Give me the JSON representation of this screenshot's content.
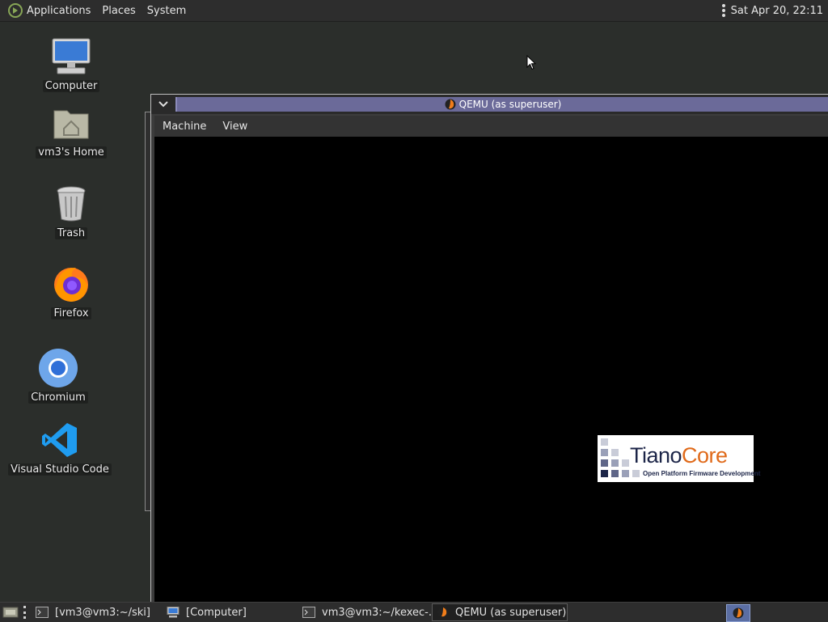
{
  "top_panel": {
    "menus": [
      "Applications",
      "Places",
      "System"
    ],
    "clock": "Sat Apr 20, 22:11"
  },
  "desktop_icons": [
    {
      "label": "Computer",
      "icon": "computer-icon"
    },
    {
      "label": "vm3's Home",
      "icon": "home-folder-icon"
    },
    {
      "label": "Trash",
      "icon": "trash-icon"
    },
    {
      "label": "Firefox",
      "icon": "firefox-icon"
    },
    {
      "label": "Chromium",
      "icon": "chromium-icon"
    },
    {
      "label": "Visual Studio Code",
      "icon": "vscode-icon"
    }
  ],
  "qemu_window": {
    "title": "QEMU (as superuser)",
    "menus": [
      "Machine",
      "View"
    ],
    "boot_logo": {
      "brand_part1": "Tiano",
      "brand_part2": "Core",
      "tagline": "Open Platform Firmware Development"
    }
  },
  "taskbar": {
    "tasks": [
      {
        "label": "[vm3@vm3:~/ski]",
        "icon": "terminal-icon"
      },
      {
        "label": "[Computer]",
        "icon": "computer-icon"
      },
      {
        "label": "vm3@vm3:~/kexec-...",
        "icon": "terminal-icon"
      },
      {
        "label": "QEMU (as superuser)",
        "icon": "qemu-icon",
        "active": true
      }
    ]
  },
  "colors": {
    "desktop_bg": "#2b2e2b",
    "panel_bg": "#2d2d2d",
    "qemu_title_accent": "#6b6a99",
    "tiano_navy": "#1c2548",
    "tiano_orange": "#e06a1a"
  }
}
